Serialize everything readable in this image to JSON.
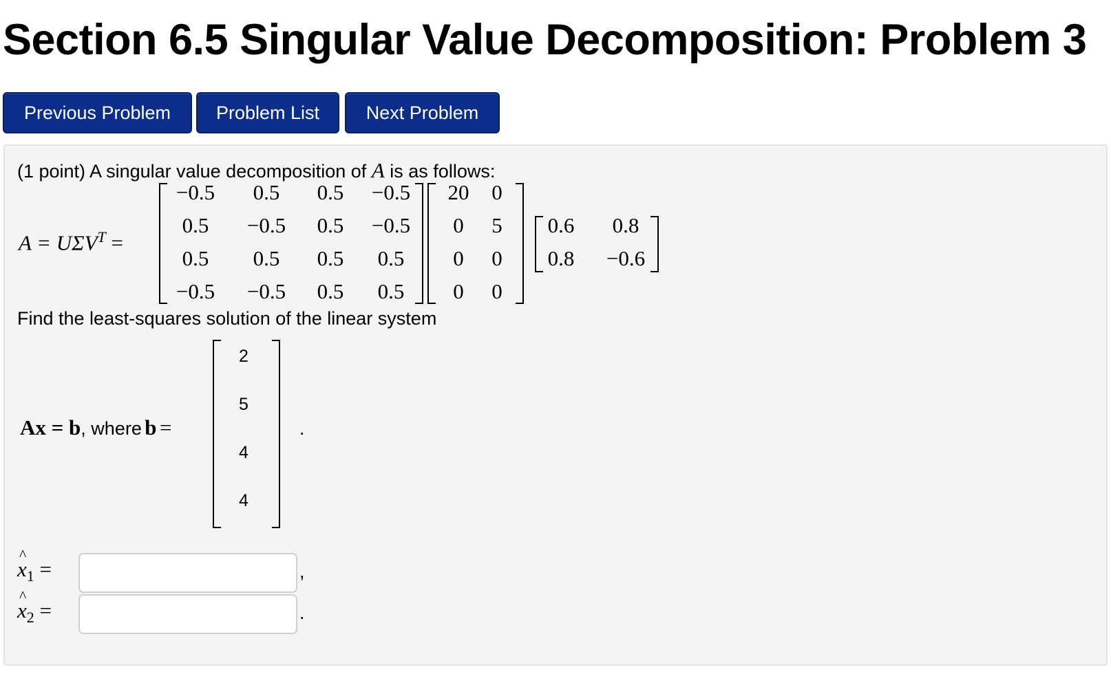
{
  "header": {
    "title": "Section 6.5 Singular Value Decomposition: Problem 3"
  },
  "nav": {
    "previous": "Previous Problem",
    "list": "Problem List",
    "next": "Next Problem"
  },
  "problem": {
    "intro_prefix": "(1 point) A singular value decomposition of",
    "intro_var": "A",
    "intro_suffix": "is as follows:",
    "svd_lhs": "A = UΣV",
    "svd_sup": "T",
    "svd_eq": "=",
    "U": [
      [
        "−0.5",
        "0.5",
        "0.5",
        "−0.5"
      ],
      [
        "0.5",
        "−0.5",
        "0.5",
        "−0.5"
      ],
      [
        "0.5",
        "0.5",
        "0.5",
        "0.5"
      ],
      [
        "−0.5",
        "−0.5",
        "0.5",
        "0.5"
      ]
    ],
    "Sigma": [
      [
        "20",
        "0"
      ],
      [
        "0",
        "5"
      ],
      [
        "0",
        "0"
      ],
      [
        "0",
        "0"
      ]
    ],
    "VT": [
      [
        "0.6",
        "0.8"
      ],
      [
        "0.8",
        "−0.6"
      ]
    ],
    "find_text": "Find the least-squares solution of the linear system",
    "system_lhs": "Ax = b",
    "where_text": ", where",
    "b_var": "b",
    "eq": "=",
    "b": [
      "2",
      "5",
      "4",
      "4"
    ],
    "period": ".",
    "answers": [
      {
        "label": "x",
        "sub": "1",
        "eq": "=",
        "value": "",
        "trailing": ","
      },
      {
        "label": "x",
        "sub": "2",
        "eq": "=",
        "value": "",
        "trailing": "."
      }
    ]
  }
}
